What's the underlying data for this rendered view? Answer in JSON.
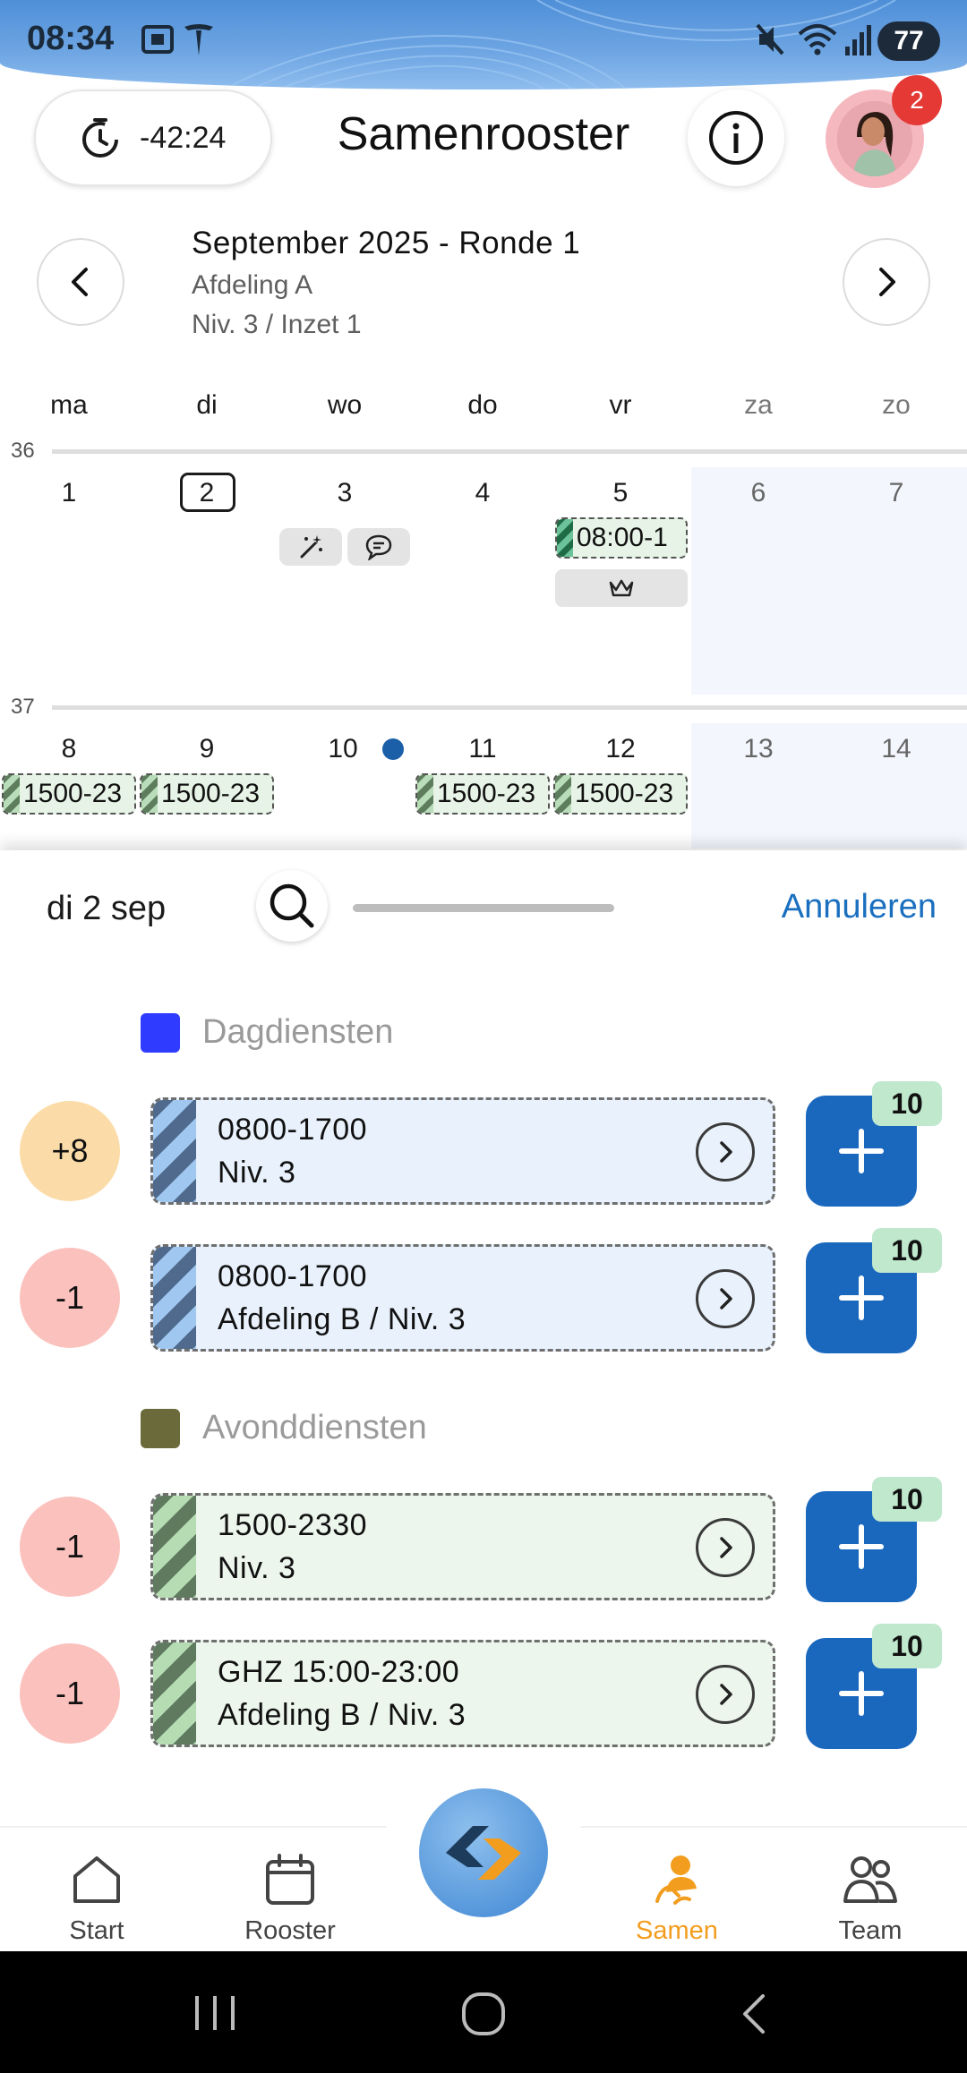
{
  "status_bar": {
    "time": "08:34",
    "battery": "77",
    "icons": [
      "screenshot-icon",
      "tesla-icon",
      "mute-icon",
      "wifi-icon",
      "signal-icon"
    ]
  },
  "header": {
    "timer": "-42:24",
    "title": "Samenrooster",
    "notification_count": "2"
  },
  "period": {
    "title": "September 2025 - Ronde 1",
    "department": "Afdeling A",
    "level": "Niv. 3 / Inzet 1"
  },
  "calendar": {
    "weekdays": [
      "ma",
      "di",
      "wo",
      "do",
      "vr",
      "za",
      "zo"
    ],
    "weeks": [
      {
        "number": "36",
        "days": [
          "1",
          "2",
          "3",
          "4",
          "5",
          "6",
          "7"
        ]
      },
      {
        "number": "37",
        "days": [
          "8",
          "9",
          "10",
          "11",
          "12",
          "13",
          "14"
        ]
      }
    ],
    "week1_shift": "08:00-1",
    "week2_shifts": [
      "1500-23",
      "1500-23",
      "1500-23",
      "1500-23"
    ]
  },
  "sheet": {
    "date": "di 2 sep",
    "cancel_label": "Annuleren",
    "groups": [
      {
        "title": "Dagdiensten",
        "color": "#2f3bff",
        "shifts": [
          {
            "count": "+8",
            "line1": "0800-1700",
            "line2": "Niv. 3",
            "available": "10"
          },
          {
            "count": "-1",
            "line1": "0800-1700",
            "line2": "Afdeling B / Niv. 3",
            "available": "10"
          }
        ]
      },
      {
        "title": "Avonddiensten",
        "color": "#6b6a3a",
        "shifts": [
          {
            "count": "-1",
            "line1": "1500-2330",
            "line2": "Niv. 3",
            "available": "10"
          },
          {
            "count": "-1",
            "line1": "GHZ 15:00-23:00",
            "line2": "Afdeling B / Niv. 3",
            "available": "10"
          }
        ]
      }
    ]
  },
  "bottom_nav": {
    "items": [
      {
        "label": "Start"
      },
      {
        "label": "Rooster"
      },
      {
        "label": "Samen"
      },
      {
        "label": "Team"
      }
    ],
    "active": "Samen"
  },
  "colors": {
    "accent_blue": "#1a68be",
    "accent_orange": "#f29d1e",
    "positive_bubble": "#fbdca8",
    "negative_bubble": "#fbc1bd"
  }
}
